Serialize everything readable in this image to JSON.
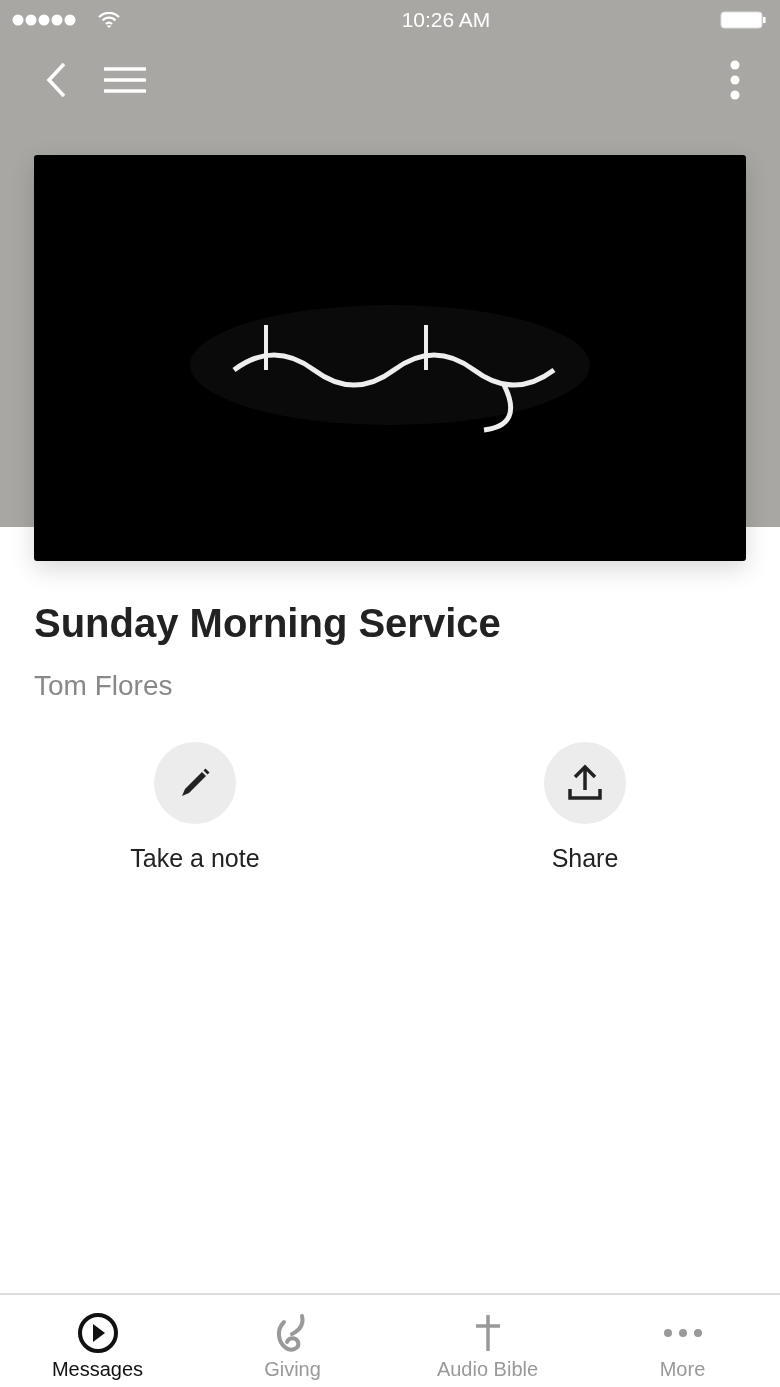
{
  "status_bar": {
    "time": "10:26 AM"
  },
  "sermon": {
    "title": "Sunday Morning Service",
    "speaker": "Tom Flores"
  },
  "actions": [
    {
      "kind": "note",
      "label": "Take a note"
    },
    {
      "kind": "share",
      "label": "Share"
    }
  ],
  "tabs": [
    {
      "kind": "play",
      "label": "Messages",
      "selected": true
    },
    {
      "kind": "giving",
      "label": "Giving",
      "selected": false
    },
    {
      "kind": "cross",
      "label": "Audio Bible",
      "selected": false
    },
    {
      "kind": "more",
      "label": "More",
      "selected": false
    }
  ]
}
